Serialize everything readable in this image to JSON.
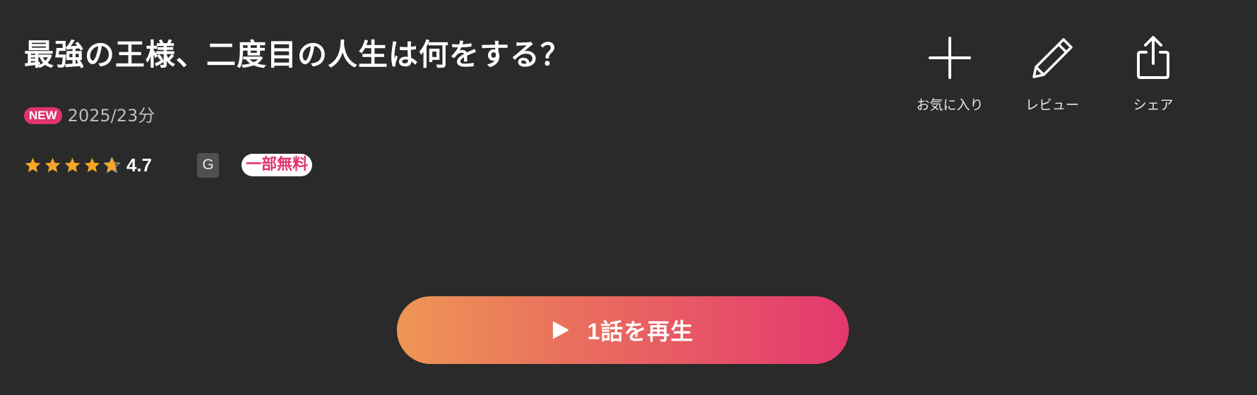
{
  "title": "最強の王様、二度目の人生は何をする？",
  "meta": {
    "new_badge": "NEW",
    "info": "2025/23分"
  },
  "rating": {
    "value": "4.7",
    "score": 4.7,
    "max": 5,
    "star_color": "#f5a623"
  },
  "age_rating": "G",
  "free_badge": "一部無料",
  "actions": {
    "favorite_label": "お気に入り",
    "review_label": "レビュー",
    "share_label": "シェア"
  },
  "play_button": {
    "label": "1話を再生",
    "icon": "play-icon"
  },
  "colors": {
    "background": "#2a2a2a",
    "accent_pink": "#e0336f",
    "gradient_start": "#ee9655",
    "gradient_end": "#e3386f"
  }
}
